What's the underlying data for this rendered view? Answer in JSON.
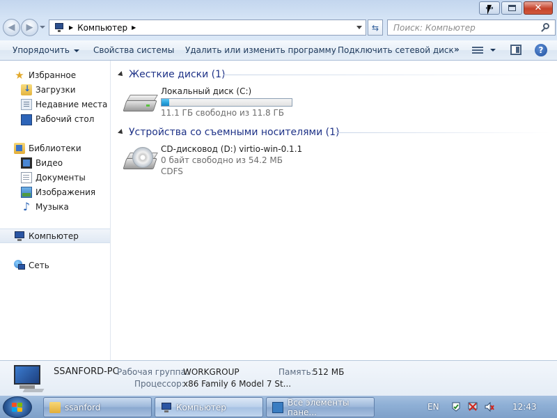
{
  "window": {
    "address": {
      "location": "Компьютер"
    },
    "search": {
      "placeholder": "Поиск: Компьютер"
    }
  },
  "toolbar": {
    "organize": "Упорядочить",
    "system_properties": "Свойства системы",
    "uninstall": "Удалить или изменить программу",
    "map_drive": "Подключить сетевой диск",
    "more": "»"
  },
  "sidebar": {
    "favorites": {
      "label": "Избранное",
      "items": [
        {
          "label": "Загрузки",
          "icon": "downloads-icon"
        },
        {
          "label": "Недавние места",
          "icon": "recent-places-icon"
        },
        {
          "label": "Рабочий стол",
          "icon": "desktop-icon"
        }
      ]
    },
    "libraries": {
      "label": "Библиотеки",
      "items": [
        {
          "label": "Видео",
          "icon": "video-icon"
        },
        {
          "label": "Документы",
          "icon": "documents-icon"
        },
        {
          "label": "Изображения",
          "icon": "pictures-icon"
        },
        {
          "label": "Музыка",
          "icon": "music-icon"
        }
      ]
    },
    "computer": {
      "label": "Компьютер",
      "selected": true
    },
    "network": {
      "label": "Сеть"
    }
  },
  "content": {
    "hard_drives": {
      "title": "Жесткие диски (1)",
      "drives": [
        {
          "name": "Локальный диск (C:)",
          "free_text": "11.1 ГБ свободно из 11.8 ГБ",
          "used_fraction": 0.06
        }
      ]
    },
    "removable": {
      "title": "Устройства со съемными носителями (1)",
      "drives": [
        {
          "name": "CD-дисковод (D:) virtio-win-0.1.1",
          "free_text": "0 байт свободно из 54.2 МБ",
          "fs": "CDFS"
        }
      ]
    }
  },
  "details": {
    "pc_name": "SSANFORD-PC",
    "workgroup_label": "Рабочая группа:",
    "workgroup_value": "WORKGROUP",
    "memory_label": "Память:",
    "memory_value": "512 МБ",
    "cpu_label": "Процессор:",
    "cpu_value": "x86 Family 6 Model 7 St..."
  },
  "taskbar": {
    "buttons": [
      {
        "label": "ssanford"
      },
      {
        "label": "Компьютер",
        "active": true
      },
      {
        "label": "Все элементы пане..."
      }
    ],
    "lang": "EN",
    "clock": "12:43"
  },
  "colors": {
    "accent": "#1e3287",
    "progress": "#26a0da",
    "taskbar": "#8fb0d6"
  }
}
